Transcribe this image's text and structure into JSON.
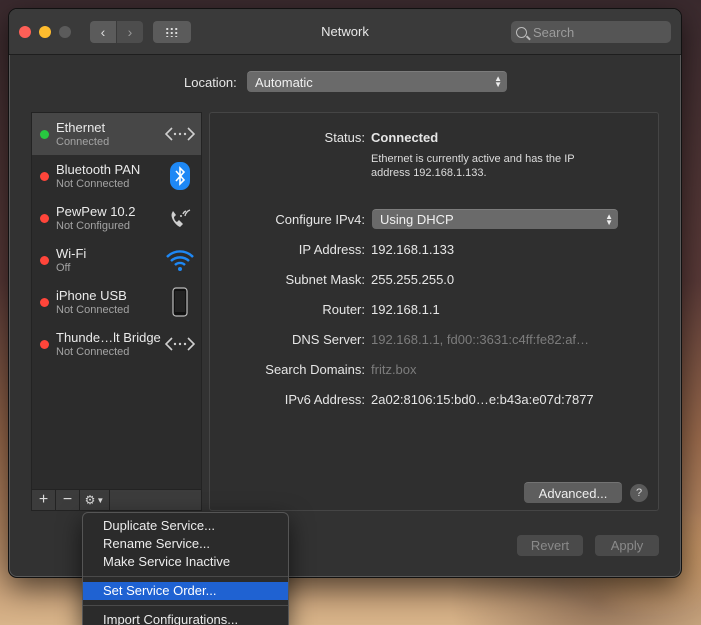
{
  "window": {
    "title": "Network",
    "search_placeholder": "Search"
  },
  "location": {
    "label": "Location:",
    "value": "Automatic"
  },
  "services": [
    {
      "name": "Ethernet",
      "status": "Connected",
      "status_color": "#28c840",
      "icon": "ethernet-icon"
    },
    {
      "name": "Bluetooth PAN",
      "status": "Not Connected",
      "status_color": "#ff453a",
      "icon": "bluetooth-icon"
    },
    {
      "name": "PewPew 10.2",
      "status": "Not Configured",
      "status_color": "#ff453a",
      "icon": "modem-phone-icon"
    },
    {
      "name": "Wi-Fi",
      "status": "Off",
      "status_color": "#ff453a",
      "icon": "wifi-icon"
    },
    {
      "name": "iPhone USB",
      "status": "Not Connected",
      "status_color": "#ff453a",
      "icon": "iphone-icon"
    },
    {
      "name": "Thunde…lt Bridge",
      "status": "Not Connected",
      "status_color": "#ff453a",
      "icon": "thunderbolt-bridge-icon"
    }
  ],
  "sidebar_footer": {
    "add": "+",
    "remove": "−",
    "action": "⚙"
  },
  "detail": {
    "status_label": "Status:",
    "status_value": "Connected",
    "status_desc": "Ethernet is currently active and has the IP address 192.168.1.133.",
    "configure_label": "Configure IPv4:",
    "configure_value": "Using DHCP",
    "ip_label": "IP Address:",
    "ip_value": "192.168.1.133",
    "subnet_label": "Subnet Mask:",
    "subnet_value": "255.255.255.0",
    "router_label": "Router:",
    "router_value": "192.168.1.1",
    "dns_label": "DNS Server:",
    "dns_value": "192.168.1.1, fd00::3631:c4ff:fe82:af…",
    "search_domains_label": "Search Domains:",
    "search_domains_value": "fritz.box",
    "ipv6_label": "IPv6 Address:",
    "ipv6_value": "2a02:8106:15:bd0…e:b43a:e07d:7877",
    "advanced_button": "Advanced...",
    "help_button": "?"
  },
  "buttons": {
    "revert": "Revert",
    "apply": "Apply"
  },
  "context_menu": {
    "items": [
      "Duplicate Service...",
      "Rename Service...",
      "Make Service Inactive",
      "Set Service Order...",
      "Import Configurations..."
    ],
    "highlighted": "Set Service Order..."
  }
}
